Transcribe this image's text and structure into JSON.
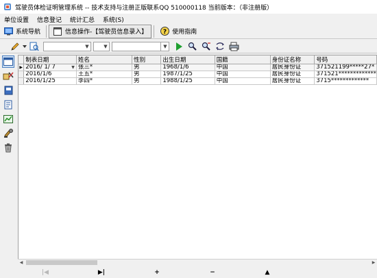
{
  "window": {
    "title": "驾驶员体检证明管理系统 -- 技术支持与注册正版联系QQ 510000118    当前版本：（非注册版）"
  },
  "menu": [
    "单位设置",
    "信息登记",
    "统计汇总",
    "系统(S)"
  ],
  "nav": {
    "system_nav": "系统导航",
    "info_tab": "信息操作-【驾驶员信息录入】",
    "guide": "使用指南"
  },
  "table": {
    "columns": [
      "制表日期",
      "姓名",
      "性别",
      "出生日期",
      "国籍",
      "身份证名称",
      "号码"
    ],
    "rows": [
      [
        "2016/ 1/ 7",
        "张三*",
        "男",
        "1968/1/6",
        "中国",
        "居民身份证",
        "371521199*****27*"
      ],
      [
        "2016/1/6",
        "王五*",
        "男",
        "1987/1/25",
        "中国",
        "居民身份证",
        "371521*************"
      ],
      [
        "2016/1/25",
        "李四*",
        "男",
        "1988/1/25",
        "中国",
        "居民身份证",
        "3715*************"
      ]
    ],
    "current_row_marker": "▶"
  },
  "footer_nav": [
    "|◀",
    "▶|",
    "+",
    "−",
    "▲"
  ],
  "colors": {
    "accent": "#4a7fc0",
    "header_bg": "#f0f0f0"
  }
}
